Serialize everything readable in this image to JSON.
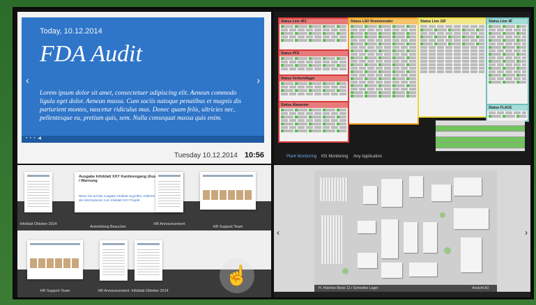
{
  "slide": {
    "date_line": "Today, 10.12.2014",
    "title": "FDA Audit",
    "body": "Lorem ipsum dolor sit amet, consectetuer adipiscing elit. Aenean commodo ligula eget dolor. Aenean massa. Cum sociis natoque penatibus et magnis dis parturient montes, nascetur ridiculus mus. Donec quam felis, ultricies nec, pellentesque eu, pretium quis, sem. Nulla consequat massa quis enim.",
    "controls": "• • • ◀",
    "prev_icon": "chevron-left-icon",
    "next_icon": "chevron-right-icon",
    "accent": "#2f75c8"
  },
  "clock": {
    "day_date": "Tuesday 10.12.2014",
    "time": "10:56"
  },
  "dashboard": {
    "panels": [
      {
        "label": "Status Line 4F1"
      },
      {
        "label": "Status LSO Remotenoder"
      },
      {
        "label": "Status Line 16F"
      },
      {
        "label": "Status Line 4F"
      },
      {
        "label": "Status PFS"
      },
      {
        "label": "Status Verbundlager"
      },
      {
        "label": "Status Abwasser"
      },
      {
        "label": "Status FLACE"
      }
    ],
    "tabs": [
      "Plant Monitoring",
      "Kfz Monitoring",
      "Any Application"
    ],
    "active_tab": 0
  },
  "documents": {
    "top_row": [
      {
        "caption": "Infoblatt Oktober 2014"
      },
      {
        "caption": "Anmeldung Besucher",
        "heading": "Ausgabe Infoblatt XXY Kantinengang (Ausfall) Kühlnetze / Warnung",
        "subtext": "Wenn Sie auf die Ausgabe Infoblatt zugreifen, erfahren Sie mehr über die Informationen zum Infoblatt XXY Projekt"
      },
      {
        "caption": "HR Announcement"
      },
      {
        "caption": "HR Support Team"
      }
    ],
    "bottom_row": [
      {
        "caption": "HR Support Team"
      },
      {
        "caption": "HR Announcement"
      },
      {
        "caption": "Infoblatt Oktober 2014"
      }
    ],
    "gesture_icon": "hand-swipe-icon"
  },
  "map": {
    "caption_left": "H. Hütchen Block 12 / Schnelles Lager",
    "caption_right": "Ansicht A3",
    "prev_icon": "chevron-left-icon",
    "next_icon": "chevron-right-icon"
  }
}
